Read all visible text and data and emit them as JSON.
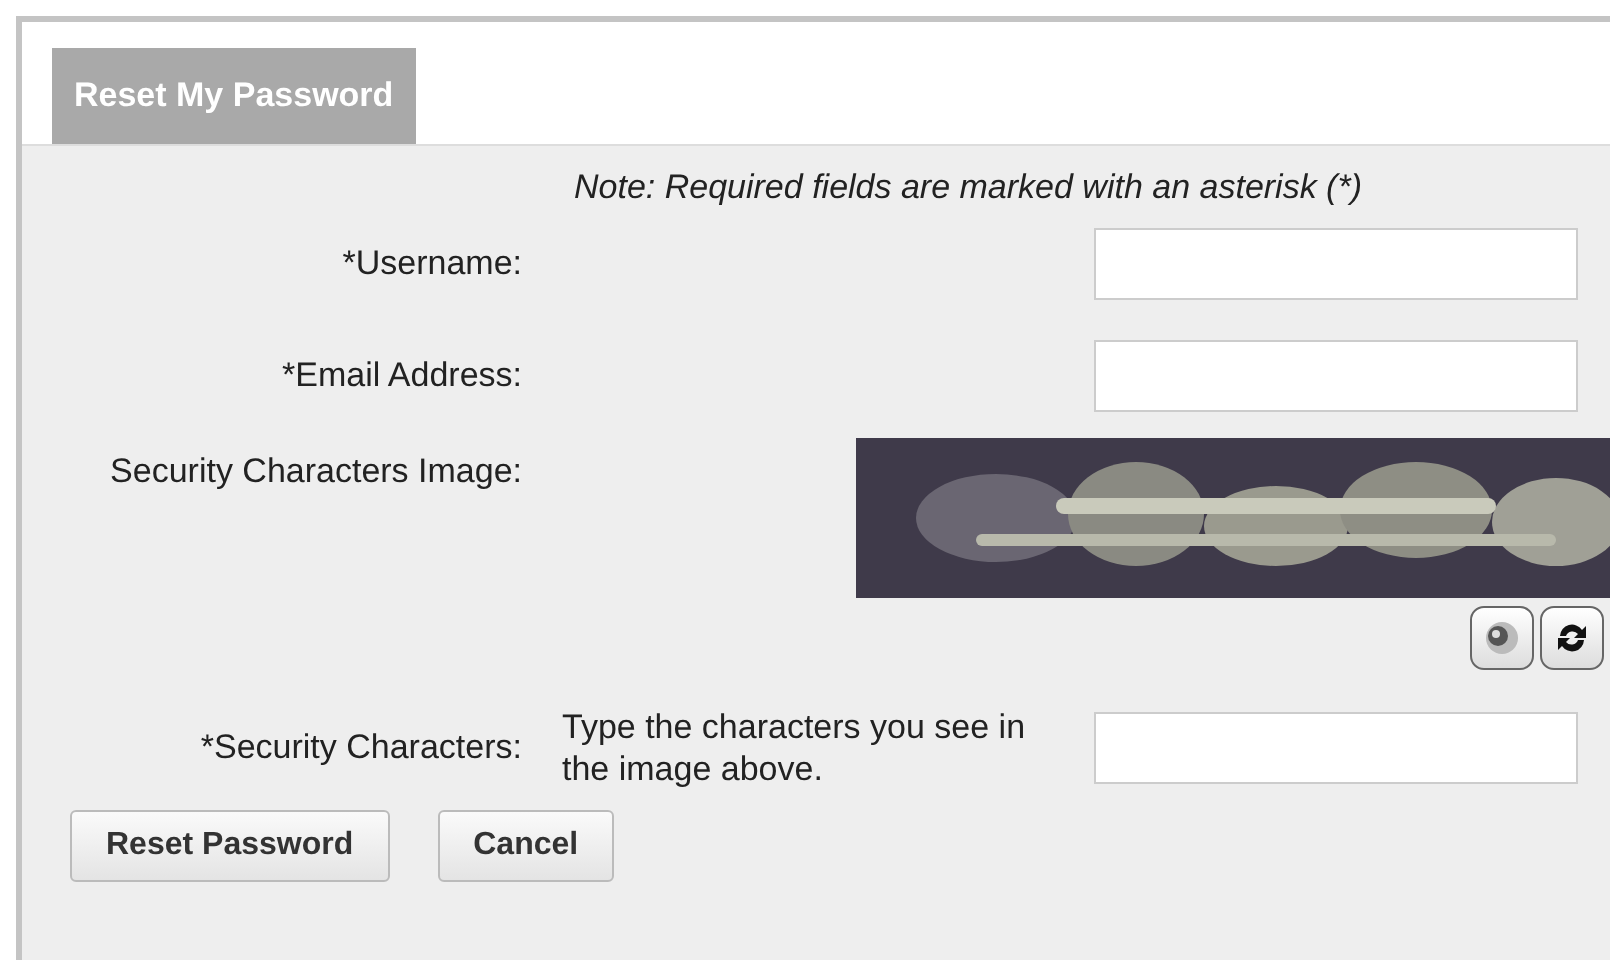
{
  "tab": {
    "label": "Reset My Password"
  },
  "note": "Note: Required fields are marked with an asterisk (*)",
  "fields": [
    {
      "label": "*Username:"
    },
    {
      "label": "*Email Address:"
    }
  ],
  "captcha": {
    "label": "Security Characters Image:",
    "kind": "picture"
  },
  "security": {
    "label": "*Security Characters:",
    "hint": "Type the characters you see in the image above."
  },
  "buttons": [
    "Reset Password",
    "Cancel"
  ]
}
